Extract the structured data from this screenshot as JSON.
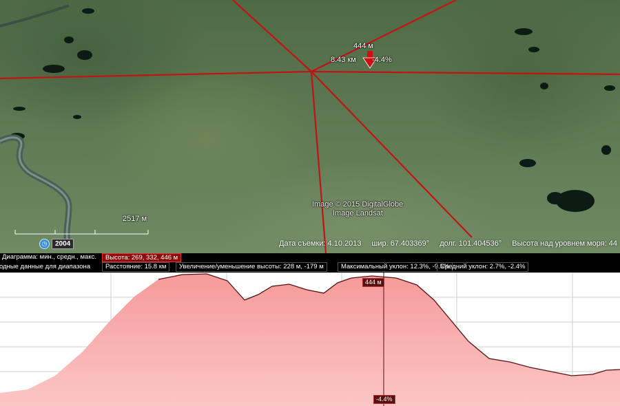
{
  "map": {
    "marker": {
      "altitude": "444 м",
      "distance": "8.43 км",
      "slope": "-4.4%"
    },
    "credits": [
      "Image © 2015 DigitalGlobe",
      "Image Landsat"
    ],
    "scale_label": "2517 м",
    "history_year": "2004",
    "status": {
      "date": "Дата съемки: 4.10.2013",
      "lat": "шир.  67.403369°",
      "lon": "долг.  101.404536°",
      "elevation": "Высота над уровнем моря:  44"
    }
  },
  "info": {
    "diagram": "Диаграмма: мин., средн., макс.",
    "range": "водные данные для диапазона",
    "height": "Высота: 269, 332, 446 м",
    "distance": "Расстояние: 15.8 км",
    "gain": "Увеличение/уменьшение высоты: 228 м, -179 м",
    "max_slope": "Максимальный уклон: 12.3%, -9.5%",
    "avg_slope": "Средний уклон: 2.7%, -2.4%"
  },
  "profile": {
    "cursor_altitude": "444 м",
    "cursor_slope": "-4.4%"
  },
  "colors": {
    "route": "#c01414",
    "profile_fill": "#f7a7a7",
    "profile_line": "#5a0e0e"
  }
}
